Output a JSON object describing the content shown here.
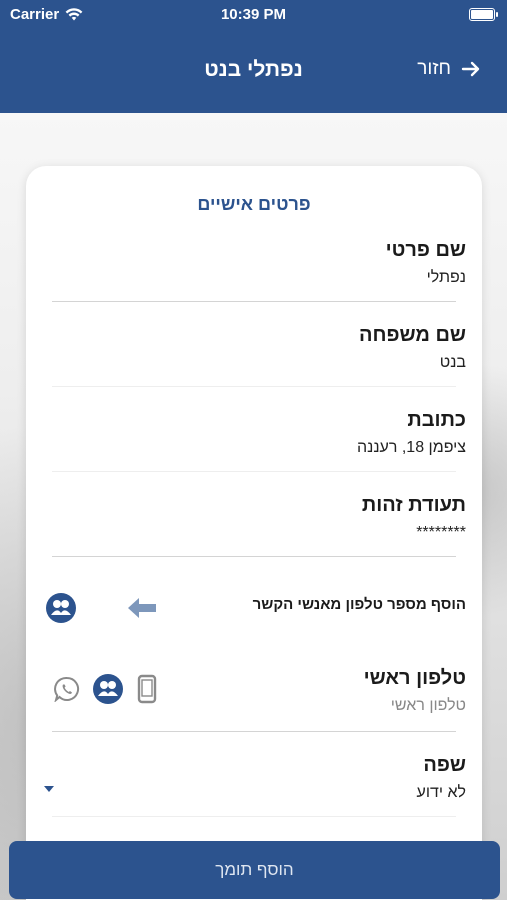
{
  "status_bar": {
    "carrier": "Carrier",
    "time": "10:39 PM"
  },
  "header": {
    "title": "נפתלי בנט",
    "back_label": "חזור"
  },
  "section_title": "פרטים אישיים",
  "fields": [
    {
      "label": "שם פרטי",
      "value": "נפתלי"
    },
    {
      "label": "שם משפחה",
      "value": "בנט"
    },
    {
      "label": "כתובת",
      "value": "ציפמן 18, רעננה"
    },
    {
      "label": "תעודת זהות",
      "value": "********"
    }
  ],
  "add_phone_text": "הוסף מספר טלפון מאנשי הקשר",
  "main_phone": {
    "label": "טלפון ראשי",
    "placeholder": "טלפון ראשי"
  },
  "language": {
    "label": "שפה",
    "value": "לא ידוע"
  },
  "bottom_button": "הוסף תומך",
  "colors": {
    "primary": "#2c538e",
    "arrow": "#7d97bb",
    "icon_gray": "#8a8a8a"
  },
  "icons": [
    "wifi-icon",
    "battery-icon",
    "back-arrow-icon",
    "contacts-icon",
    "left-arrow-icon",
    "whatsapp-icon",
    "phone-icon",
    "dropdown-icon"
  ]
}
